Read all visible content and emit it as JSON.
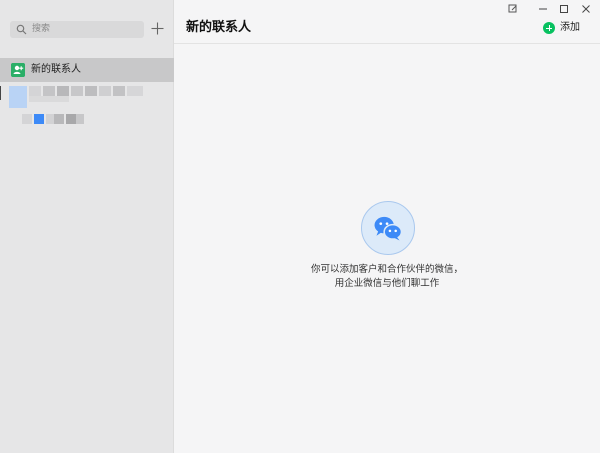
{
  "sidebar": {
    "search": {
      "placeholder": "搜索"
    },
    "nav_items": [
      {
        "label": "新的联系人",
        "icon": "new-contact-icon"
      }
    ]
  },
  "main": {
    "title": "新的联系人",
    "add_button": {
      "label": "添加",
      "icon": "plus-circle-icon"
    },
    "empty_state": {
      "icon": "wechat-chat-bubbles-icon",
      "line1": "你可以添加客户和合作伙伴的微信，",
      "line2": "用企业微信与他们聊工作"
    }
  },
  "window_controls": [
    "pin-icon",
    "minimize-icon",
    "maximize-icon",
    "close-icon"
  ],
  "colors": {
    "accent_green": "#07c160",
    "contact_icon_green": "#2aae67",
    "sidebar_bg": "#e6e6e7",
    "selected_bg": "#c8c8c9",
    "blue": "#3d8af7"
  }
}
